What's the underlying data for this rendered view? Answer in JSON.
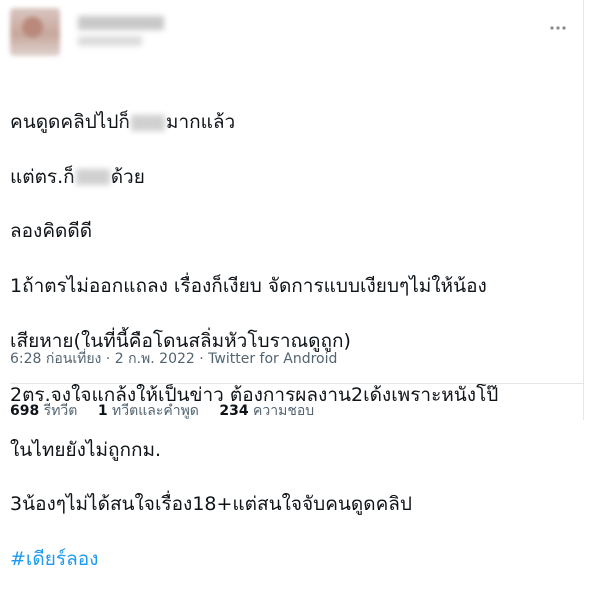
{
  "tweet": {
    "menu_icon": "more-horizontal-icon",
    "lines": {
      "l1a": "คนดูดคลิปไปก็",
      "l1b": "มากแล้ว",
      "l2a": "แต่ตร.ก็",
      "l2b": "ด้วย",
      "l3": "ลองคิดดีดี",
      "l4": "1ถ้าตรไม่ออกแถลง เรื่องก็เงียบ จัดการแบบเงียบๆไม่ให้น้อง",
      "l5": "เสียหาย(ในที่นี้คือโดนสลิ่มหัวโบราณดูถูก)",
      "l6": "2ตร.จงใจแกล้งให้เป็นข่าว ต้องการผลงาน2เด้งเพราะหนังโป๊",
      "l7": "ในไทยยังไม่ถูกกม.",
      "l8": "3น้องๆไม่ได้สนใจเรื่อง18+แต่สนใจจับคนดูดคลิป",
      "hashtag": "#เดียร์ลอง"
    },
    "meta": {
      "time": "6:28 ก่อนเที่ยง",
      "sep1": " · ",
      "date": "2 ก.พ. 2022",
      "sep2": " · ",
      "source": "Twitter for Android"
    },
    "stats": {
      "retweets_num": "698",
      "retweets_label": " รีทวีต",
      "quotes_num": "1",
      "quotes_label": " ทวีตและคำพูด",
      "likes_num": "234",
      "likes_label": " ความชอบ"
    },
    "colors": {
      "text": "#0f1419",
      "secondary": "#536471",
      "link": "#1d9bf0"
    }
  }
}
